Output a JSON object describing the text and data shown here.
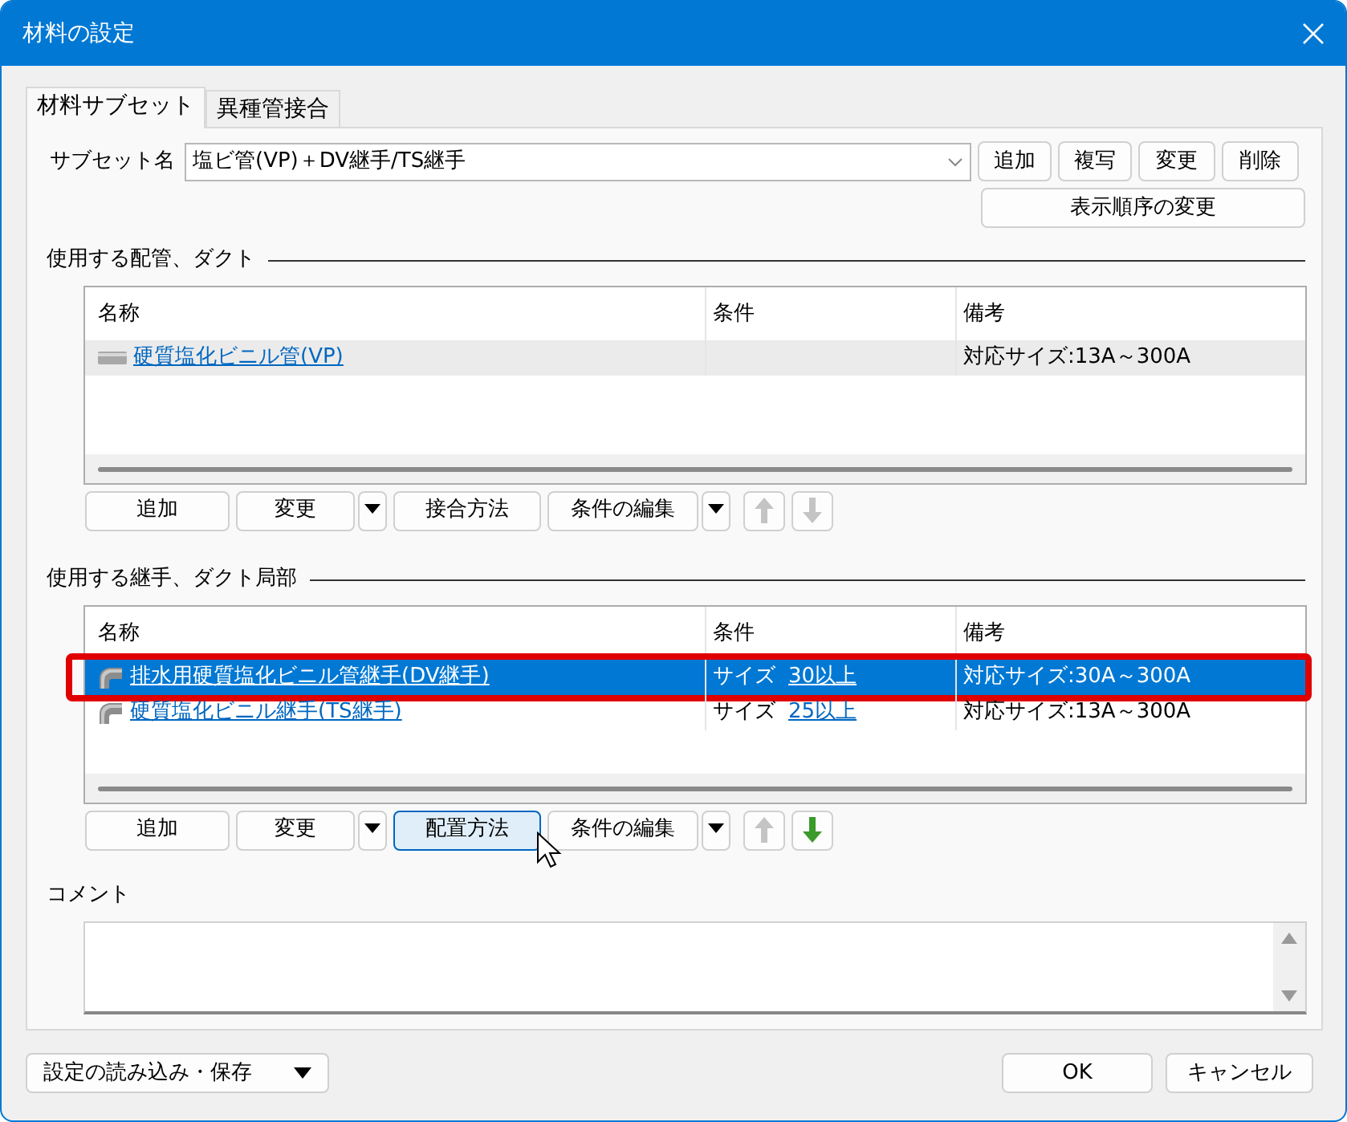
{
  "window": {
    "title": "材料の設定"
  },
  "tabs": [
    {
      "label": "材料サブセット",
      "selected": true
    },
    {
      "label": "異種管接合",
      "selected": false
    }
  ],
  "subset": {
    "label": "サブセット名",
    "value": "塩ビ管(VP)＋DV継手/TS継手",
    "buttons": [
      "追加",
      "複写",
      "変更",
      "削除"
    ],
    "reorder_button": "表示順序の変更"
  },
  "sections": [
    {
      "heading": "使用する配管、ダクト",
      "focused": false,
      "columns": [
        "名称",
        "条件",
        "備考"
      ],
      "rows": [
        {
          "kind": "pipe",
          "name": "硬質塩化ビニル管(VP)",
          "note": "対応サイズ:13A～300A",
          "selected": true,
          "highlighted": false
        }
      ],
      "buttons": [
        {
          "kind": "button",
          "label": "追加",
          "hovered": false
        },
        {
          "kind": "button",
          "label": "変更",
          "hovered": false
        },
        {
          "kind": "dropdown"
        },
        {
          "kind": "button",
          "label": "接合方法",
          "hovered": false
        },
        {
          "kind": "button",
          "label": "条件の編集",
          "hovered": false
        },
        {
          "kind": "dropdown"
        },
        {
          "kind": "up",
          "disabled": true
        },
        {
          "kind": "down",
          "disabled": true
        }
      ]
    },
    {
      "heading": "使用する継手、ダクト局部",
      "focused": true,
      "columns": [
        "名称",
        "条件",
        "備考"
      ],
      "rows": [
        {
          "kind": "elbow",
          "name": "排水用硬質塩化ビニル管継手(DV継手)",
          "condition_label": "サイズ",
          "condition_value": "30以上",
          "note": "対応サイズ:30A～300A",
          "selected": true,
          "highlighted": true
        },
        {
          "kind": "elbow",
          "name": "硬質塩化ビニル継手(TS継手)",
          "condition_label": "サイズ",
          "condition_value": "25以上",
          "note": "対応サイズ:13A～300A",
          "selected": false,
          "highlighted": false
        }
      ],
      "buttons": [
        {
          "kind": "button",
          "label": "追加",
          "hovered": false
        },
        {
          "kind": "button",
          "label": "変更",
          "hovered": false
        },
        {
          "kind": "dropdown"
        },
        {
          "kind": "button",
          "label": "配置方法",
          "hovered": true
        },
        {
          "kind": "button",
          "label": "条件の編集",
          "hovered": false
        },
        {
          "kind": "dropdown"
        },
        {
          "kind": "up",
          "disabled": true
        },
        {
          "kind": "down",
          "disabled": false
        }
      ]
    }
  ],
  "comment": {
    "label": "コメント"
  },
  "footer": {
    "menu_button": "設定の読み込み・保存",
    "ok": "OK",
    "cancel": "キャンセル"
  }
}
